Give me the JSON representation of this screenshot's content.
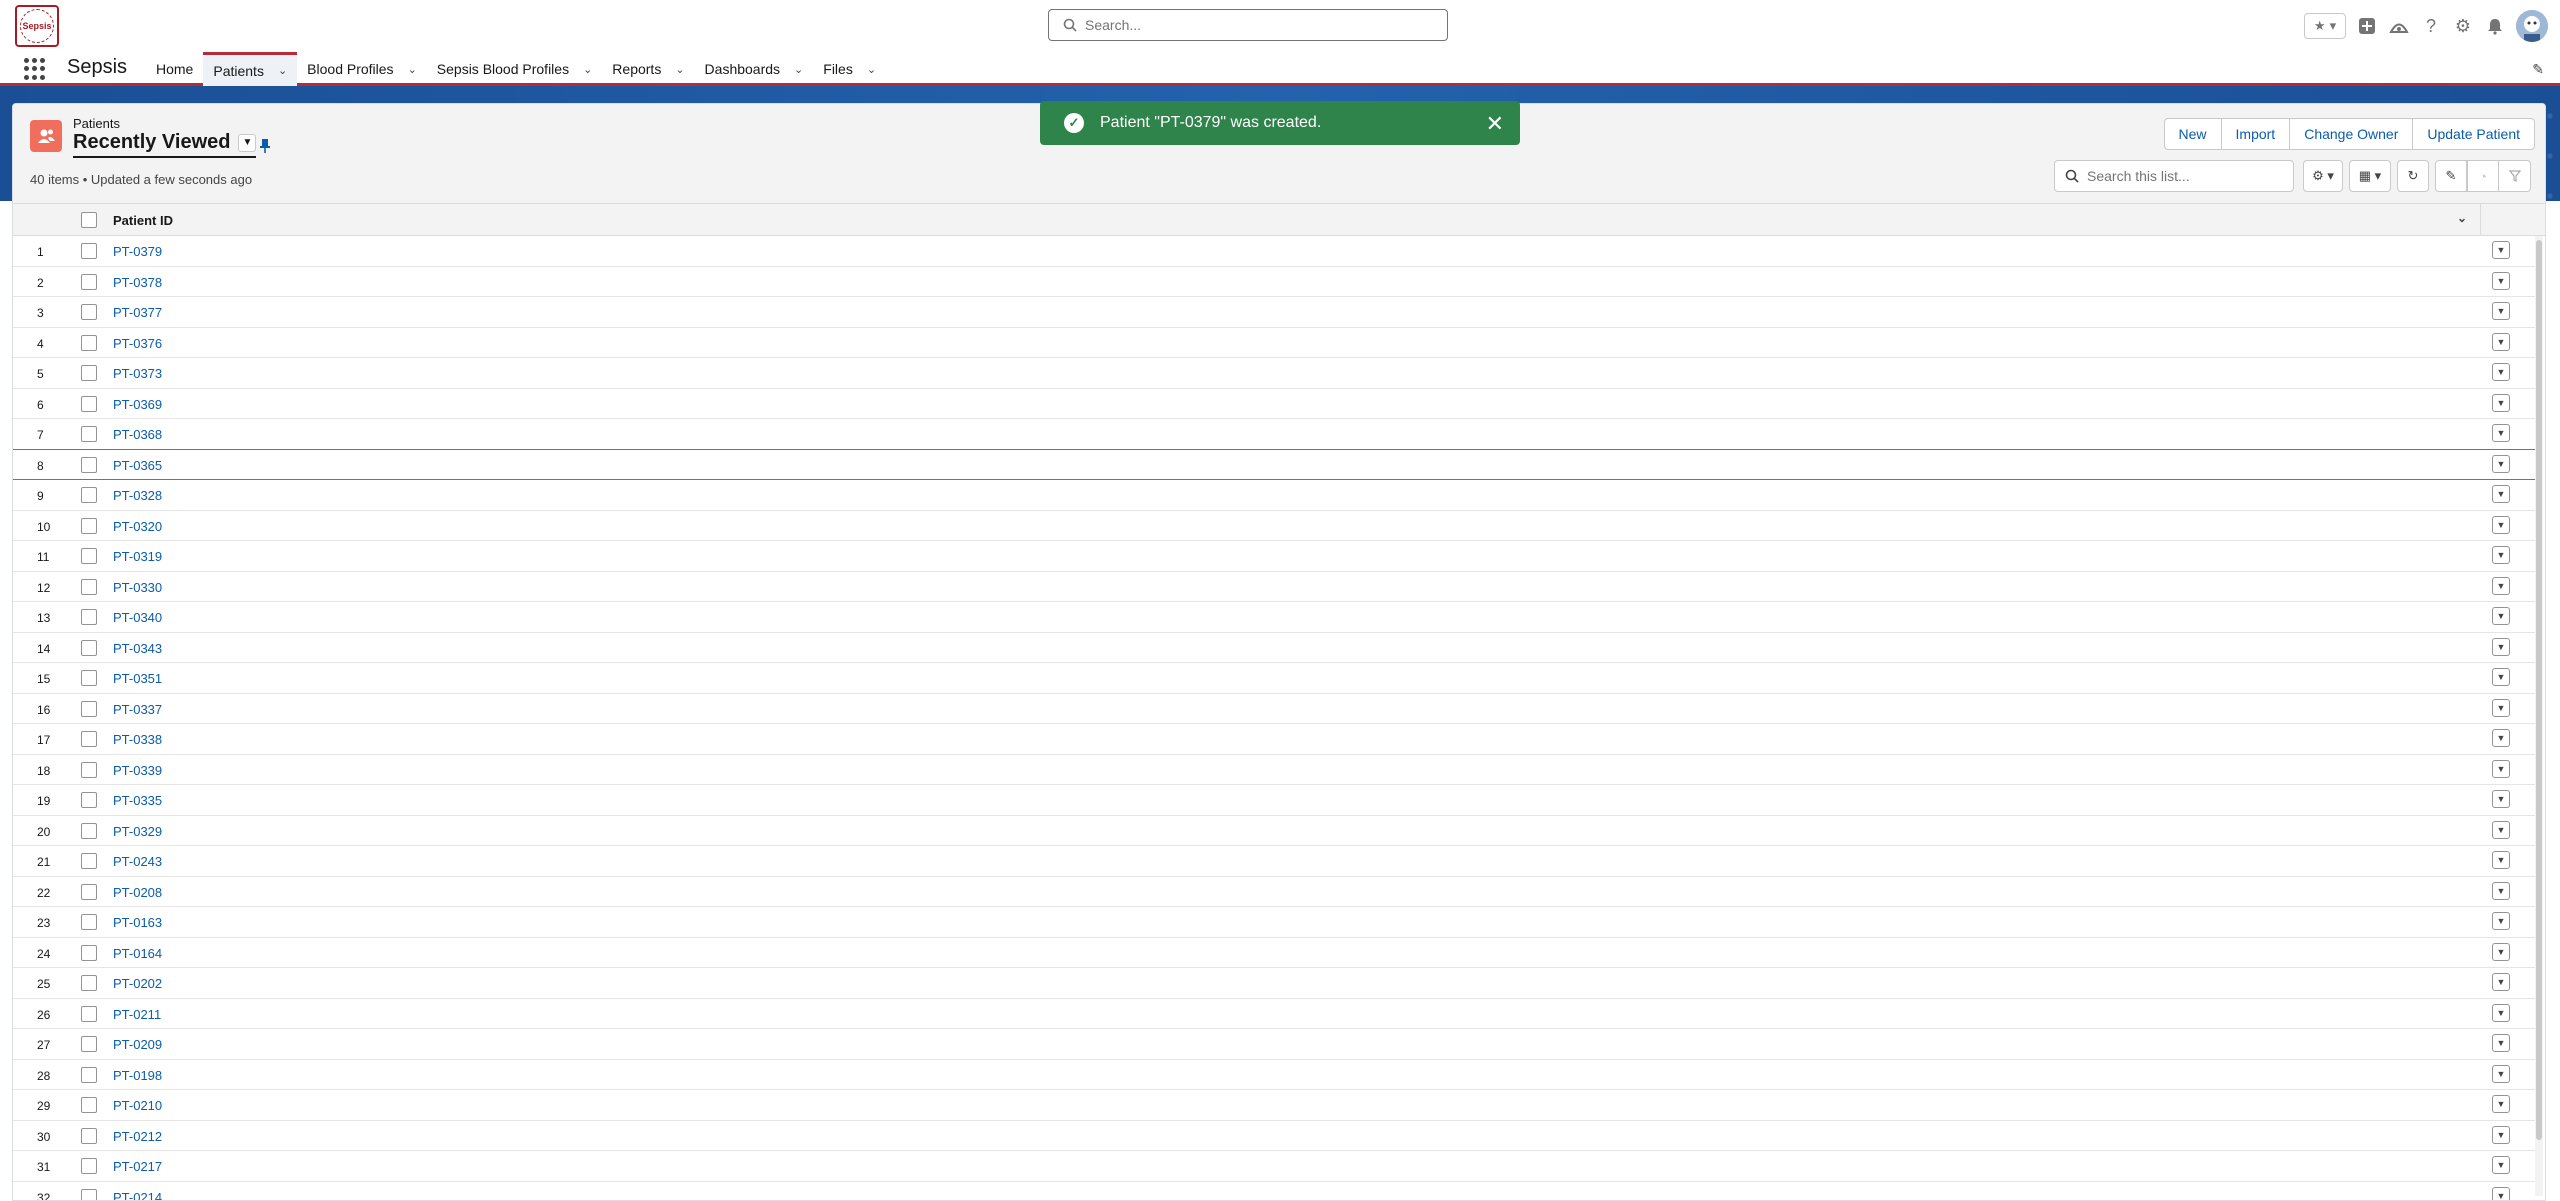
{
  "global": {
    "logo_text": "Sepsis",
    "search_placeholder": "Search..."
  },
  "nav": {
    "app_name": "Sepsis",
    "items": [
      {
        "label": "Home",
        "has_menu": false,
        "active": false
      },
      {
        "label": "Patients",
        "has_menu": true,
        "active": true
      },
      {
        "label": "Blood Profiles",
        "has_menu": true,
        "active": false
      },
      {
        "label": "Sepsis Blood Profiles",
        "has_menu": true,
        "active": false
      },
      {
        "label": "Reports",
        "has_menu": true,
        "active": false
      },
      {
        "label": "Dashboards",
        "has_menu": true,
        "active": false
      },
      {
        "label": "Files",
        "has_menu": true,
        "active": false
      }
    ]
  },
  "list": {
    "object_label": "Patients",
    "view_name": "Recently Viewed",
    "meta": "40 items • Updated a few seconds ago",
    "search_placeholder": "Search this list...",
    "column_header": "Patient ID",
    "actions": [
      "New",
      "Import",
      "Change Owner",
      "Update Patient"
    ]
  },
  "toast": {
    "message": "Patient \"PT-0379\" was created."
  },
  "rows": [
    {
      "num": "1",
      "id": "PT-0379"
    },
    {
      "num": "2",
      "id": "PT-0378"
    },
    {
      "num": "3",
      "id": "PT-0377"
    },
    {
      "num": "4",
      "id": "PT-0376"
    },
    {
      "num": "5",
      "id": "PT-0373"
    },
    {
      "num": "6",
      "id": "PT-0369"
    },
    {
      "num": "7",
      "id": "PT-0368"
    },
    {
      "num": "8",
      "id": "PT-0365"
    },
    {
      "num": "9",
      "id": "PT-0328"
    },
    {
      "num": "10",
      "id": "PT-0320"
    },
    {
      "num": "11",
      "id": "PT-0319"
    },
    {
      "num": "12",
      "id": "PT-0330"
    },
    {
      "num": "13",
      "id": "PT-0340"
    },
    {
      "num": "14",
      "id": "PT-0343"
    },
    {
      "num": "15",
      "id": "PT-0351"
    },
    {
      "num": "16",
      "id": "PT-0337"
    },
    {
      "num": "17",
      "id": "PT-0338"
    },
    {
      "num": "18",
      "id": "PT-0339"
    },
    {
      "num": "19",
      "id": "PT-0335"
    },
    {
      "num": "20",
      "id": "PT-0329"
    },
    {
      "num": "21",
      "id": "PT-0243"
    },
    {
      "num": "22",
      "id": "PT-0208"
    },
    {
      "num": "23",
      "id": "PT-0163"
    },
    {
      "num": "24",
      "id": "PT-0164"
    },
    {
      "num": "25",
      "id": "PT-0202"
    },
    {
      "num": "26",
      "id": "PT-0211"
    },
    {
      "num": "27",
      "id": "PT-0209"
    },
    {
      "num": "28",
      "id": "PT-0198"
    },
    {
      "num": "29",
      "id": "PT-0210"
    },
    {
      "num": "30",
      "id": "PT-0212"
    },
    {
      "num": "31",
      "id": "PT-0217"
    },
    {
      "num": "32",
      "id": "PT-0214"
    }
  ]
}
